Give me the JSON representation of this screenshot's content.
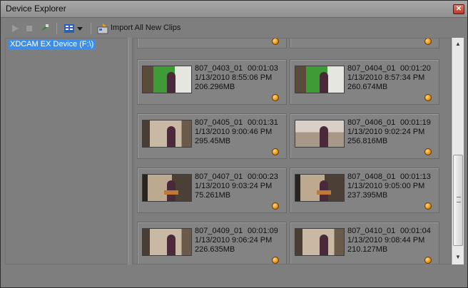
{
  "window": {
    "title": "Device Explorer",
    "close_glyph": "✕"
  },
  "toolbar": {
    "play_icon": "play-icon",
    "stop_icon": "stop-icon",
    "eject_icon": "eject-icon",
    "view_icon": "view-list-icon",
    "import_label": "Import All New Clips"
  },
  "tree": {
    "device_label": "XDCAM EX Device (F:\\)"
  },
  "clips": [
    {
      "name": "807_0403_01",
      "duration": "00:01:03",
      "date": "1/13/2010 8:55:06 PM",
      "size": "206.296MB",
      "thumb": "green"
    },
    {
      "name": "807_0404_01",
      "duration": "00:01:20",
      "date": "1/13/2010 8:57:34 PM",
      "size": "260.674MB",
      "thumb": "green"
    },
    {
      "name": "807_0405_01",
      "duration": "00:01:31",
      "date": "1/13/2010 9:00:46 PM",
      "size": "295.45MB",
      "thumb": "room"
    },
    {
      "name": "807_0406_01",
      "duration": "00:01:19",
      "date": "1/13/2010 9:02:24 PM",
      "size": "256.816MB",
      "thumb": "wall"
    },
    {
      "name": "807_0407_01",
      "duration": "00:00:23",
      "date": "1/13/2010 9:03:24 PM",
      "size": "75.261MB",
      "thumb": "stage"
    },
    {
      "name": "807_0408_01",
      "duration": "00:01:13",
      "date": "1/13/2010 9:05:00 PM",
      "size": "237.395MB",
      "thumb": "stage"
    },
    {
      "name": "807_0409_01",
      "duration": "00:01:09",
      "date": "1/13/2010 9:06:24 PM",
      "size": "226.635MB",
      "thumb": "room"
    },
    {
      "name": "807_0410_01",
      "duration": "00:01:04",
      "date": "1/13/2010 9:08:44 PM",
      "size": "210.127MB",
      "thumb": "room"
    }
  ],
  "colors": {
    "selection": "#3c8ee8",
    "status_dot": "#e89214"
  }
}
